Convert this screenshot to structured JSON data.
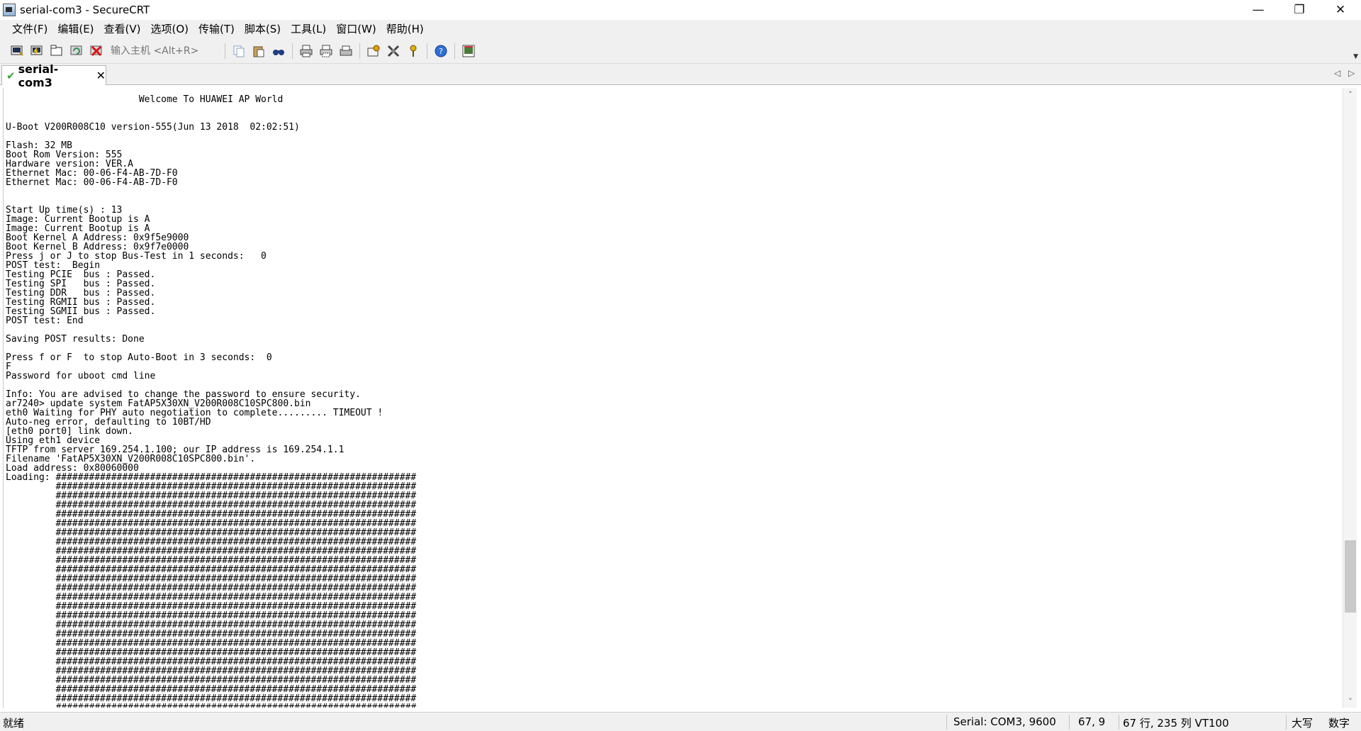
{
  "window": {
    "title": "serial-com3 - SecureCRT",
    "minimize": "—",
    "restore": "❐",
    "close": "✕"
  },
  "menu": [
    "文件(F)",
    "编辑(E)",
    "查看(V)",
    "选项(O)",
    "传输(T)",
    "脚本(S)",
    "工具(L)",
    "窗口(W)",
    "帮助(H)"
  ],
  "toolbar": {
    "host_placeholder": "输入主机 <Alt+R>",
    "icons": [
      "connect-icon",
      "quick-connect-icon",
      "connect-in-tab-icon",
      "reconnect-icon",
      "disconnect-icon",
      "copy-icon",
      "paste-icon",
      "find-icon",
      "print-icon",
      "print-selection-icon",
      "printer-setup-icon",
      "session-options-icon",
      "global-options-icon",
      "keymap-icon",
      "help-icon",
      "about-icon"
    ]
  },
  "tab": {
    "label": "serial-com3",
    "close": "✕",
    "nav_left": "◁",
    "nav_right": "▷"
  },
  "terminal": {
    "lines": [
      "                        Welcome To HUAWEI AP World",
      "",
      "",
      "U-Boot V200R008C10 version-555(Jun 13 2018  02:02:51)",
      "",
      "Flash: 32 MB",
      "Boot Rom Version: 555",
      "Hardware version: VER.A",
      "Ethernet Mac: 00-06-F4-AB-7D-F0",
      "Ethernet Mac: 00-06-F4-AB-7D-F0",
      "",
      "",
      "Start Up time(s) : 13",
      "Image: Current Bootup is A",
      "Image: Current Bootup is A",
      "Boot Kernel A Address: 0x9f5e9000",
      "Boot Kernel B Address: 0x9f7e0000",
      "Press j or J to stop Bus-Test in 1 seconds:   0",
      "POST test:  Begin",
      "Testing PCIE  bus : Passed.",
      "Testing SPI   bus : Passed.",
      "Testing DDR   bus : Passed.",
      "Testing RGMII bus : Passed.",
      "Testing SGMII bus : Passed.",
      "POST test: End",
      "",
      "Saving POST results: Done",
      "",
      "Press f or F  to stop Auto-Boot in 3 seconds:  0",
      "F",
      "Password for uboot cmd line",
      "",
      "Info: You are advised to change the password to ensure security.",
      "ar7240> update system FatAP5X30XN_V200R008C10SPC800.bin",
      "eth0 Waiting for PHY auto negotiation to complete......... TIMEOUT !",
      "Auto-neg error, defaulting to 10BT/HD",
      "[eth0 port0] link down.",
      "Using eth1 device",
      "TFTP from server 169.254.1.100; our IP address is 169.254.1.1",
      "Filename 'FatAP5X30XN_V200R008C10SPC800.bin'.",
      "Load address: 0x80060000",
      "Loading: #################################################################",
      "         #################################################################",
      "         #################################################################",
      "         #################################################################",
      "         #################################################################",
      "         #################################################################",
      "         #################################################################",
      "         #################################################################",
      "         #################################################################",
      "         #################################################################",
      "         #################################################################",
      "         #################################################################",
      "         #################################################################",
      "         #################################################################",
      "         #################################################################",
      "         #################################################################",
      "         #################################################################",
      "         #################################################################",
      "         #################################################################",
      "         #################################################################",
      "         #################################################################",
      "         #################################################################",
      "         #################################################################",
      "         #################################################################",
      "         #################################################################",
      "         #################################################################"
    ]
  },
  "scrollbar": {
    "up": "˄",
    "down": "˅"
  },
  "status": {
    "ready": "就绪",
    "connection": "Serial: COM3, 9600",
    "cursor": "67,   9",
    "size": "67 行, 235 列  VT100",
    "caps": "大写",
    "num": "数字"
  }
}
